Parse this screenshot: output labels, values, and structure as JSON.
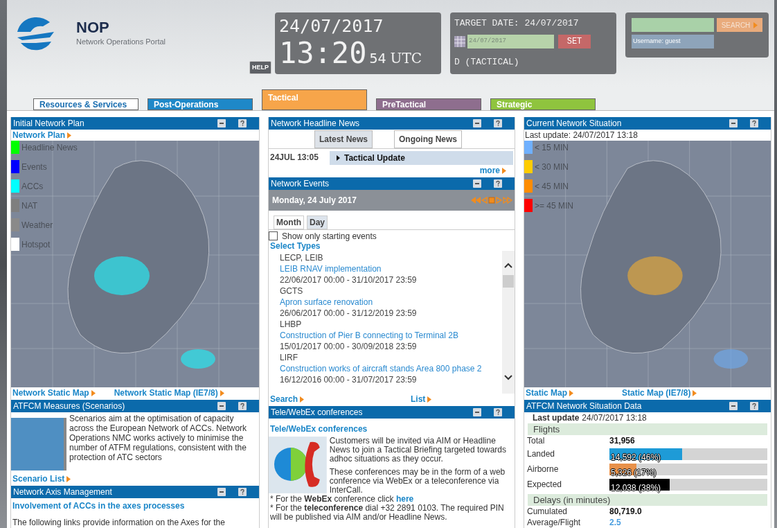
{
  "header": {
    "logo_title": "NOP",
    "logo_subtitle": "Network Operations Portal",
    "help": "HELP",
    "date": "24/07/2017",
    "time": "13:20",
    "seconds": "54",
    "zone": "UTC",
    "target_label": "TARGET DATE: 24/07/2017",
    "target_value": "24/07/2017",
    "set": "SET",
    "mode": "D (TACTICAL)",
    "search_button": "SEARCH",
    "username": "Username: guest"
  },
  "tabs": [
    {
      "label": "Resources & Services",
      "color": "#ffffff",
      "selected": false
    },
    {
      "label": "Post-Operations",
      "color": "#1e88c8",
      "selected": false
    },
    {
      "label": "Tactical",
      "color": "#f7a54a",
      "selected": true
    },
    {
      "label": "PreTactical",
      "color": "#8e6e8e",
      "selected": false
    },
    {
      "label": "Strategic",
      "color": "#8fc43e",
      "selected": false
    }
  ],
  "initial_network_plan": {
    "title": "Initial Network Plan",
    "link": "Network Plan",
    "legend": [
      {
        "label": "Headline News",
        "color": "#00ff00"
      },
      {
        "label": "Events",
        "color": "#0000ff"
      },
      {
        "label": "ACCs",
        "color": "#00ffff"
      },
      {
        "label": "NAT",
        "color": "#7f7f7f"
      },
      {
        "label": "Weather",
        "color": "#8a8a8a"
      },
      {
        "label": "Hotspot",
        "color": "#ffffff"
      }
    ],
    "links": [
      "Network Static Map",
      "Network Static Map (IE7/8)"
    ]
  },
  "atfcm_measures": {
    "title": "ATFCM Measures (Scenarios)",
    "text": "Scenarios aim at the optimisation of capacity across the European Network of ACCs. Network Operations NMC works actively to minimise the number of ATFM regulations, consistent with the protection of ATC sectors",
    "link": "Scenario List"
  },
  "axis_management": {
    "title": "Network Axis Management",
    "link": "Involvement of ACCs in the axes processes",
    "text": "The following links provide information on the Axes for the"
  },
  "headline_news": {
    "title": "Network Headline News",
    "tabs": [
      {
        "label": "Latest News",
        "selected": true
      },
      {
        "label": "Ongoing News",
        "selected": false
      }
    ],
    "items": [
      {
        "time": "24JUL 13:05",
        "title": "Tactical Update"
      }
    ],
    "more": "more"
  },
  "network_events": {
    "title": "Network Events",
    "date": "Monday, 24 July 2017",
    "views": [
      {
        "label": "Month",
        "selected": false
      },
      {
        "label": "Day",
        "selected": true
      }
    ],
    "filter": {
      "label": "Show only starting events",
      "checked": false
    },
    "select_types": "Select Types",
    "events": [
      {
        "code": "LECP, LEIB",
        "title": "LEIB RNAV implementation",
        "period": "22/06/2017 00:00 - 31/10/2017 23:59"
      },
      {
        "code": "GCTS",
        "title": "Apron surface renovation",
        "period": "26/06/2017 00:00 - 31/12/2019 23:59"
      },
      {
        "code": "LHBP",
        "title": "Construction of Pier B connecting to Terminal 2B",
        "period": "15/01/2017 00:00 - 30/09/2018 23:59"
      },
      {
        "code": "LIRF",
        "title": "Construction works of aircraft stands Area 800 phase 2",
        "period": "16/12/2016 00:00 - 31/07/2017 23:59"
      }
    ],
    "links": [
      "Search",
      "List"
    ]
  },
  "conferences": {
    "title": "Tele/WebEx conferences",
    "link": "Tele/WebEx conferences",
    "paragraphs": [
      "Customers will be invited via AIM or Headline News to join a Tactical Briefing targeted towards adhoc situations as they occur.",
      "These conferences may be in the form of a web conference via WebEx or a teleconference via InterCall."
    ],
    "instructions": [
      {
        "text": "* For the **WebEx** conference click",
        "link": "here"
      },
      {
        "text": "* For the **teleconference** dial +32 2891 0103. The required PIN will be published via AIM and/or Headline News."
      }
    ]
  },
  "current_situation": {
    "title": "Current Network Situation",
    "last_update": "Last update: 24/07/2017 13:18",
    "legend": [
      {
        "label": "< 15 MIN",
        "color": "#6fb0ff"
      },
      {
        "label": "< 30 MIN",
        "color": "#ffcc00"
      },
      {
        "label": "< 45 MIN",
        "color": "#ff8c00"
      },
      {
        "label": ">= 45 MIN",
        "color": "#ff0000"
      }
    ],
    "links": [
      "Static Map",
      "Static Map (IE7/8)"
    ]
  },
  "situation_data": {
    "title": "ATFCM Network Situation Data",
    "last_update_label": "Last update",
    "last_update_value": "24/07/2017 13:18",
    "flights_heading": "Flights",
    "total": {
      "label": "Total",
      "value": "31,956"
    },
    "bars": [
      {
        "label": "Landed",
        "value": "14,592 (46%)",
        "level": 0.46,
        "color": "#1e9bd7"
      },
      {
        "label": "Airborne",
        "value": "5,326 (17%)",
        "level": 0.17,
        "color": "#e8914a"
      },
      {
        "label": "Expected",
        "value": "12,038 (38%)",
        "level": 0.38,
        "color": "#000000"
      }
    ],
    "delays_heading": "Delays (in minutes)",
    "delays": [
      {
        "label": "Cumulated",
        "value": "80,719.0",
        "kind": "total"
      },
      {
        "label": "Average/Flight",
        "value": "2.5",
        "kind": "average"
      }
    ]
  }
}
